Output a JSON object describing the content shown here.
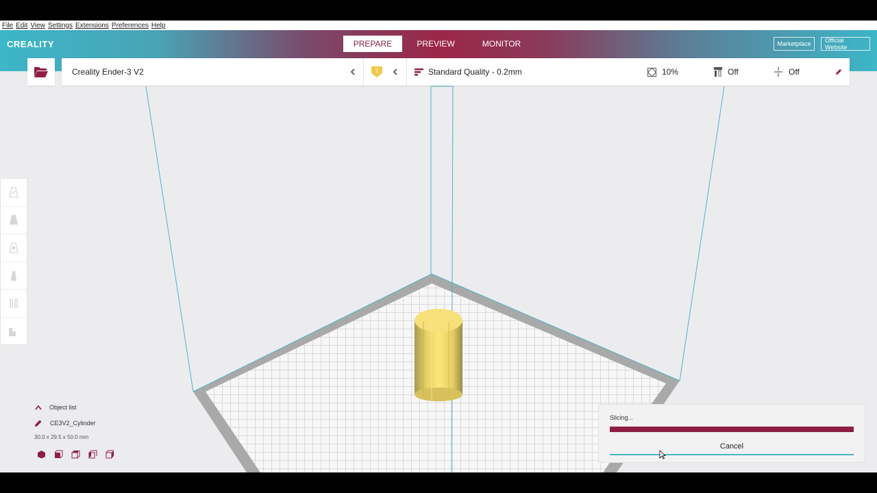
{
  "menu": [
    "File",
    "Edit",
    "View",
    "Settings",
    "Extensions",
    "Preferences",
    "Help"
  ],
  "header": {
    "logo": "CREALITY",
    "tabs": [
      {
        "label": "PREPARE",
        "active": true
      },
      {
        "label": "PREVIEW",
        "active": false
      },
      {
        "label": "MONITOR",
        "active": false
      }
    ],
    "marketplace_label": "Marketplace",
    "website_label": "Official Website"
  },
  "toolbar": {
    "printer": "Creality Ender-3 V2",
    "extruder_badge": "1",
    "quality": "Standard Quality - 0.2mm",
    "infill": "10%",
    "support": "Off",
    "adhesion": "Off"
  },
  "side_tools": [
    "move-tool-icon",
    "scale-tool-icon",
    "rotate-tool-icon",
    "mirror-tool-icon",
    "per-model-settings-icon",
    "support-blocker-icon"
  ],
  "object_panel": {
    "title": "Object list",
    "object_name": "CE3V2_Cylinder",
    "dimensions": "30.0 x 29.5 x 50.0 mm",
    "view_buttons": [
      "3d-view-icon",
      "front-view-icon",
      "top-view-icon",
      "left-view-icon",
      "right-view-icon"
    ]
  },
  "slicing": {
    "status": "Slicing...",
    "progress": 1.0,
    "cancel_label": "Cancel"
  },
  "colors": {
    "accent": "#8e1e43",
    "teal": "#3cb6c8",
    "model": "#f5dc6a"
  }
}
